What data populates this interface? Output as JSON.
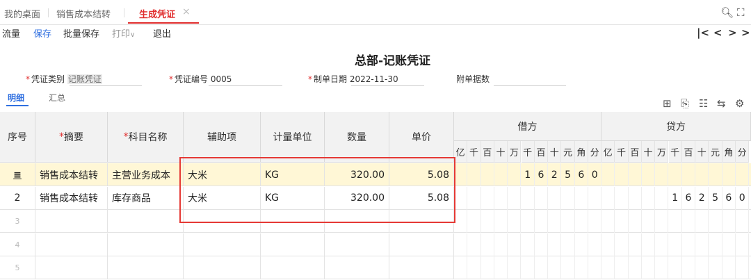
{
  "tabs": {
    "home": "我的桌面",
    "sales": "销售成本结转",
    "voucher": "生成凭证",
    "close": "×"
  },
  "toolbar": {
    "flow": "流量",
    "save": "保存",
    "batch_save": "批量保存",
    "print": "打印",
    "exit": "退出"
  },
  "nav": {
    "first": "|<",
    "prev": "<",
    "next": ">",
    "last": ">|"
  },
  "document": {
    "title": "总部-记账凭证",
    "voucher_type_label": "凭证类别",
    "voucher_type_value": "记账凭证",
    "voucher_no_label": "凭证编号",
    "voucher_no_value": "0005",
    "date_label": "制单日期",
    "date_value": "2022-11-30",
    "attachments_label": "附单据数"
  },
  "subtabs": {
    "detail": "明细",
    "summary": "汇总"
  },
  "table": {
    "headers": {
      "seq": "序号",
      "summary": "摘要",
      "account": "科目名称",
      "aux": "辅助项",
      "unit": "计量单位",
      "qty": "数量",
      "price": "单价",
      "debit": "借方",
      "credit": "贷方"
    },
    "digit_headers": [
      "亿",
      "千",
      "百",
      "十",
      "万",
      "千",
      "百",
      "十",
      "元",
      "角",
      "分"
    ],
    "rows": [
      {
        "seq": "≡",
        "summary": "销售成本结转",
        "account": "主营业务成本",
        "aux": "大米",
        "unit": "KG",
        "qty": "320.00",
        "price": "5.08",
        "debit": [
          "",
          "",
          "",
          "",
          "",
          "1",
          "6",
          "2",
          "5",
          "6",
          "0"
        ],
        "credit": [
          "",
          "",
          "",
          "",
          "",
          "",
          "",
          "",
          "",
          "",
          ""
        ]
      },
      {
        "seq": "2",
        "summary": "销售成本结转",
        "account": "库存商品",
        "aux": "大米",
        "unit": "KG",
        "qty": "320.00",
        "price": "5.08",
        "debit": [
          "",
          "",
          "",
          "",
          "",
          "",
          "",
          "",
          "",
          "",
          ""
        ],
        "credit": [
          "",
          "",
          "",
          "",
          "",
          "1",
          "6",
          "2",
          "5",
          "6",
          "0"
        ]
      },
      {
        "seq": "3"
      },
      {
        "seq": "4"
      },
      {
        "seq": "5"
      }
    ]
  }
}
